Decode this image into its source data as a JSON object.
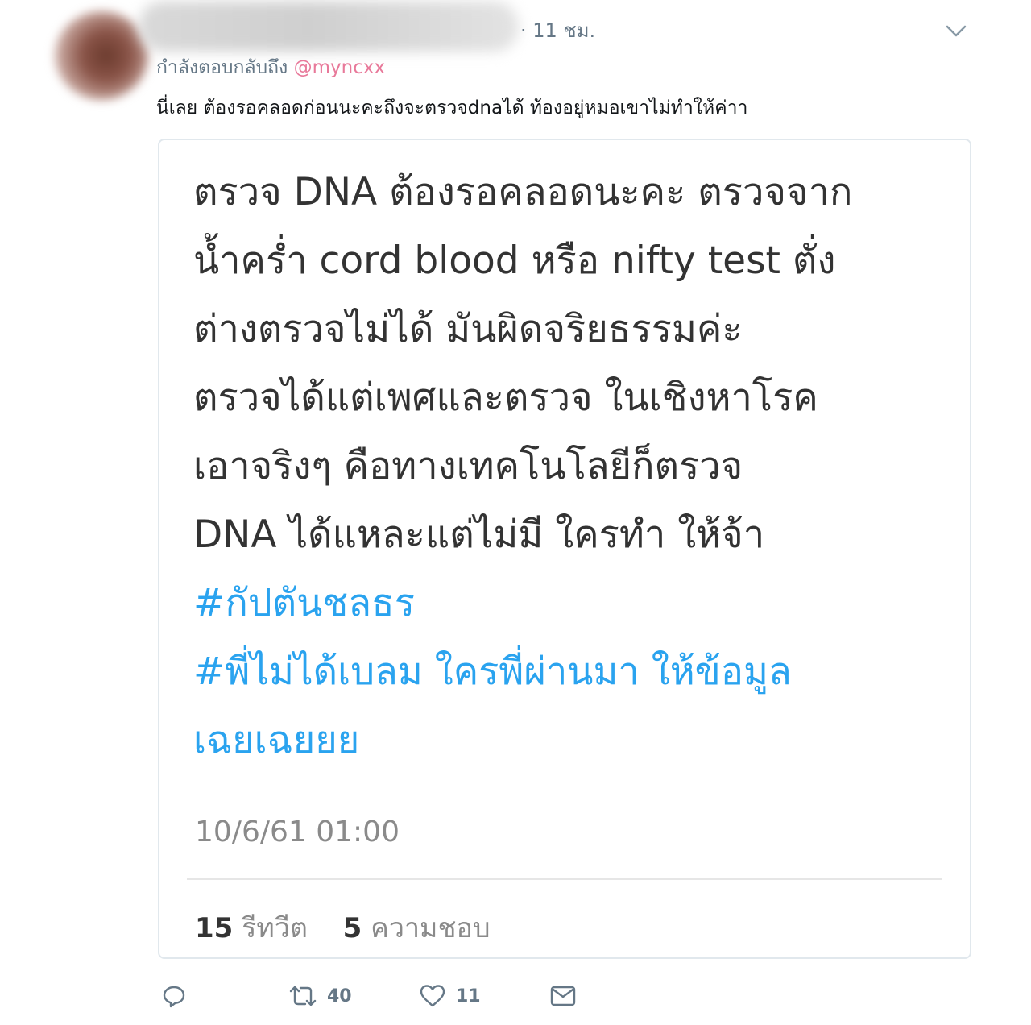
{
  "tweet": {
    "timestamp": "· 11 ชม.",
    "reply_prefix": "กำลังตอบกลับถึง ",
    "reply_mention": "@myncxx",
    "text": "นี่เลย ต้องรอคลอดก่อนนะคะถึงจะตรวจdnaได้ ท้องอยู่หมอเขาไม่ทำให้ค่าา"
  },
  "quoted": {
    "lines": [
      "ตรวจ DNA ต้องรอคลอดนะคะ ตรวจจาก",
      "น้ำคร่ำ cord blood หรือ nifty test ตั่ง",
      "ต่างตรวจไม่ได้ มันผิดจริยธรรมค่ะ",
      "ตรวจได้แต่เพศและตรวจ ในเชิงหาโรค",
      "เอาจริงๆ คือทางเทคโนโลยีก็ตรวจ",
      "DNA ได้แหละแต่ไม่มี ใครทำ ให้จ้า"
    ],
    "hashtags": [
      "#กัปตันชลธร",
      "#พี่ไม่ได้เบลม ใครพี่ผ่านมา ให้ข้อมูล",
      "เฉยเฉยยย"
    ],
    "date": "10/6/61 01:00",
    "retweets_count": "15",
    "retweets_label": "รีทวีต",
    "likes_count": "5",
    "likes_label": "ความชอบ"
  },
  "actions": {
    "reply_icon": "reply-icon",
    "retweet_icon": "retweet-icon",
    "retweet_count": "40",
    "like_icon": "heart-icon",
    "like_count": "11",
    "dm_icon": "envelope-icon"
  },
  "colors": {
    "mention": "#e8799a",
    "hashtag": "#2aa3ef",
    "secondary_text": "#657786",
    "border": "#e1e8ed"
  }
}
